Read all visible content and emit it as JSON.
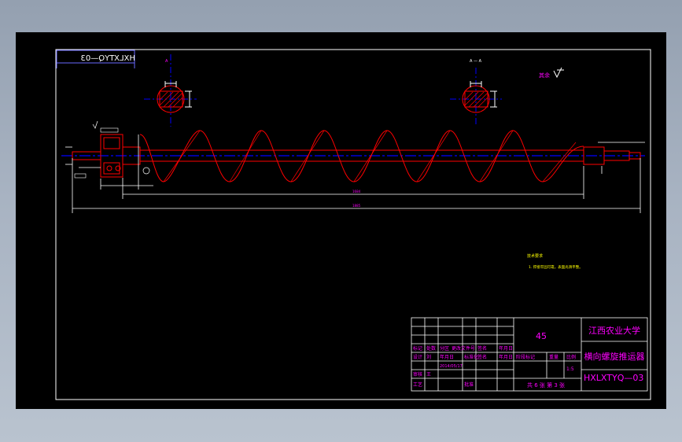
{
  "drawing_no_mirrored": "HXLXTYQ—03",
  "section_label": "A — A",
  "roughness_note": "其余",
  "tech_req_title": "技术要求",
  "tech_req_line1": "1. 焊接牢固可靠，表面光滑平整。",
  "dim_total": "1885",
  "dim_middle": "1684",
  "title_block": {
    "material": "45",
    "university": "江西农业大学",
    "product_name": "横向螺旋推运器",
    "drawing_no": "HXLXTYQ—03",
    "header_row1": [
      "标记",
      "处数",
      "分区",
      "更改文件号",
      "签名",
      "年月日"
    ],
    "header_row2": [
      "设计",
      "刘",
      "年月日",
      "标准化",
      "签名",
      "年月日"
    ],
    "header_row3": [
      "审核",
      "王"
    ],
    "header_row4": [
      "工艺",
      "批准"
    ],
    "stage_label": "阶段标记",
    "weight_label": "重量",
    "scale_label": "比例",
    "scale_value": "1:5",
    "sheet_info": "共 6 张  第 3 张",
    "date_value": "2014/05/17"
  },
  "colors": {
    "sheet": "#000000",
    "border": "#ffffff",
    "outline": "#ff0000",
    "dimension": "#ffffff",
    "text": "#ff00ff",
    "centerline": "#0000ff",
    "annotation": "#ffff00"
  }
}
